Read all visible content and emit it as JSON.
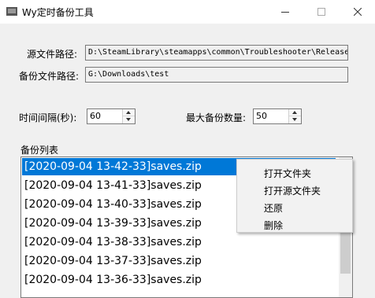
{
  "window": {
    "title": "Wy定时备份工具",
    "icon": "app-icon",
    "controls": [
      "minimize-icon",
      "maximize-icon",
      "close-icon"
    ]
  },
  "paths": {
    "source_label": "源文件路径:",
    "source_value": "D:\\SteamLibrary\\steamapps\\common\\Troubleshooter\\Release",
    "backup_label": "备份文件路径:",
    "backup_value": "G:\\Downloads\\test"
  },
  "settings": {
    "interval_label": "时间间隔(秒):",
    "interval_value": "60",
    "max_label": "最大备份数量:",
    "max_value": "50"
  },
  "backup_list": {
    "label": "备份列表",
    "selected_index": 0,
    "items": [
      "[2020-09-04 13-42-33]saves.zip",
      "[2020-09-04 13-41-33]saves.zip",
      "[2020-09-04 13-40-33]saves.zip",
      "[2020-09-04 13-39-33]saves.zip",
      "[2020-09-04 13-38-33]saves.zip",
      "[2020-09-04 13-37-33]saves.zip",
      "[2020-09-04 13-36-33]saves.zip"
    ]
  },
  "context_menu": {
    "items": [
      "打开文件夹",
      "打开源文件夹",
      "还原",
      "删除"
    ]
  },
  "colors": {
    "selection": "#0078d7",
    "window_bg": "#f0f0f0"
  }
}
